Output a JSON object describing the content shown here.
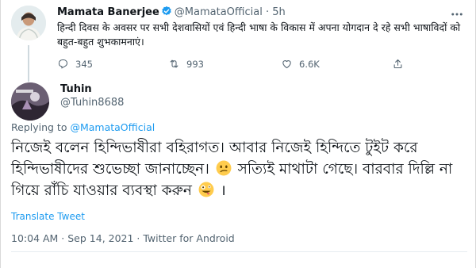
{
  "parent_tweet": {
    "author_name": "Mamata Banerjee",
    "handle": "@MamataOfficial",
    "separator": "·",
    "time": "5h",
    "text": "हिन्दी दिवस के अवसर पर सभी देशवासियों एवं हिन्दी भाषा के विकास में अपना योगदान दे रहे सभी भाषाविदों को बहुत-बहुत शुभकामनाएं।",
    "reply_count": "345",
    "retweet_count": "993",
    "like_count": "6.6K",
    "accent_color": "#1d9bf0"
  },
  "reply_tweet": {
    "author_name": "Tuhin",
    "handle": "@Tuhin8688",
    "replying_to_label": "Replying to",
    "replying_to_handle": "@MamataOfficial",
    "text_part1": "নিজেই বলেন হিন্দিভাষীরা বহিরাগত। আবার নিজেই হিন্দিতে টুইট করে হিন্দিভাষীদের শুভেচ্ছা জানাচ্ছেন।",
    "text_part2": "সত্যিই মাথাটা গেছে। বারবার দিল্লি না গিয়ে রাঁচি যাওয়ার ব্যবস্থা করুন",
    "text_part3": "।",
    "translate_label": "Translate Tweet",
    "meta": "10:04 AM · Sep 14, 2021 · Twitter for Android"
  },
  "icons": [
    "verified-icon",
    "more-icon",
    "reply-icon",
    "retweet-icon",
    "like-icon",
    "share-icon",
    "confused-emoji-icon",
    "zany-emoji-icon"
  ]
}
